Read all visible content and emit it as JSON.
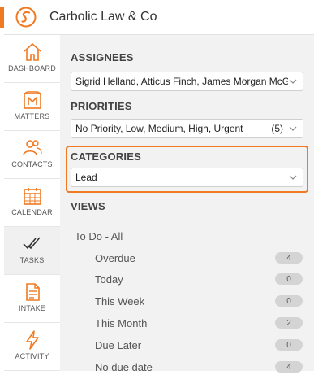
{
  "app": {
    "title": "Carbolic Law & Co",
    "brand_color": "#f07a22"
  },
  "sidebar": {
    "items": [
      {
        "label": "DASHBOARD",
        "icon": "home-icon"
      },
      {
        "label": "MATTERS",
        "icon": "briefcase-icon"
      },
      {
        "label": "CONTACTS",
        "icon": "users-icon"
      },
      {
        "label": "CALENDAR",
        "icon": "calendar-icon"
      },
      {
        "label": "TASKS",
        "icon": "checkmarks-icon",
        "active": true
      },
      {
        "label": "INTAKE",
        "icon": "document-icon"
      },
      {
        "label": "ACTIVITY",
        "icon": "lightning-icon"
      }
    ]
  },
  "filters": {
    "assignees": {
      "title": "ASSIGNEES",
      "value": "Sigrid Helland, Atticus Finch, James Morgan McGill"
    },
    "priorities": {
      "title": "PRIORITIES",
      "value": "No Priority, Low, Medium, High, Urgent",
      "count": "(5)"
    },
    "categories": {
      "title": "CATEGORIES",
      "value": "Lead"
    }
  },
  "views": {
    "title": "VIEWS",
    "root": "To Do - All",
    "items": [
      {
        "label": "Overdue",
        "count": "4"
      },
      {
        "label": "Today",
        "count": "0"
      },
      {
        "label": "This Week",
        "count": "0"
      },
      {
        "label": "This Month",
        "count": "2"
      },
      {
        "label": "Due Later",
        "count": "0"
      },
      {
        "label": "No due date",
        "count": "4"
      }
    ]
  }
}
